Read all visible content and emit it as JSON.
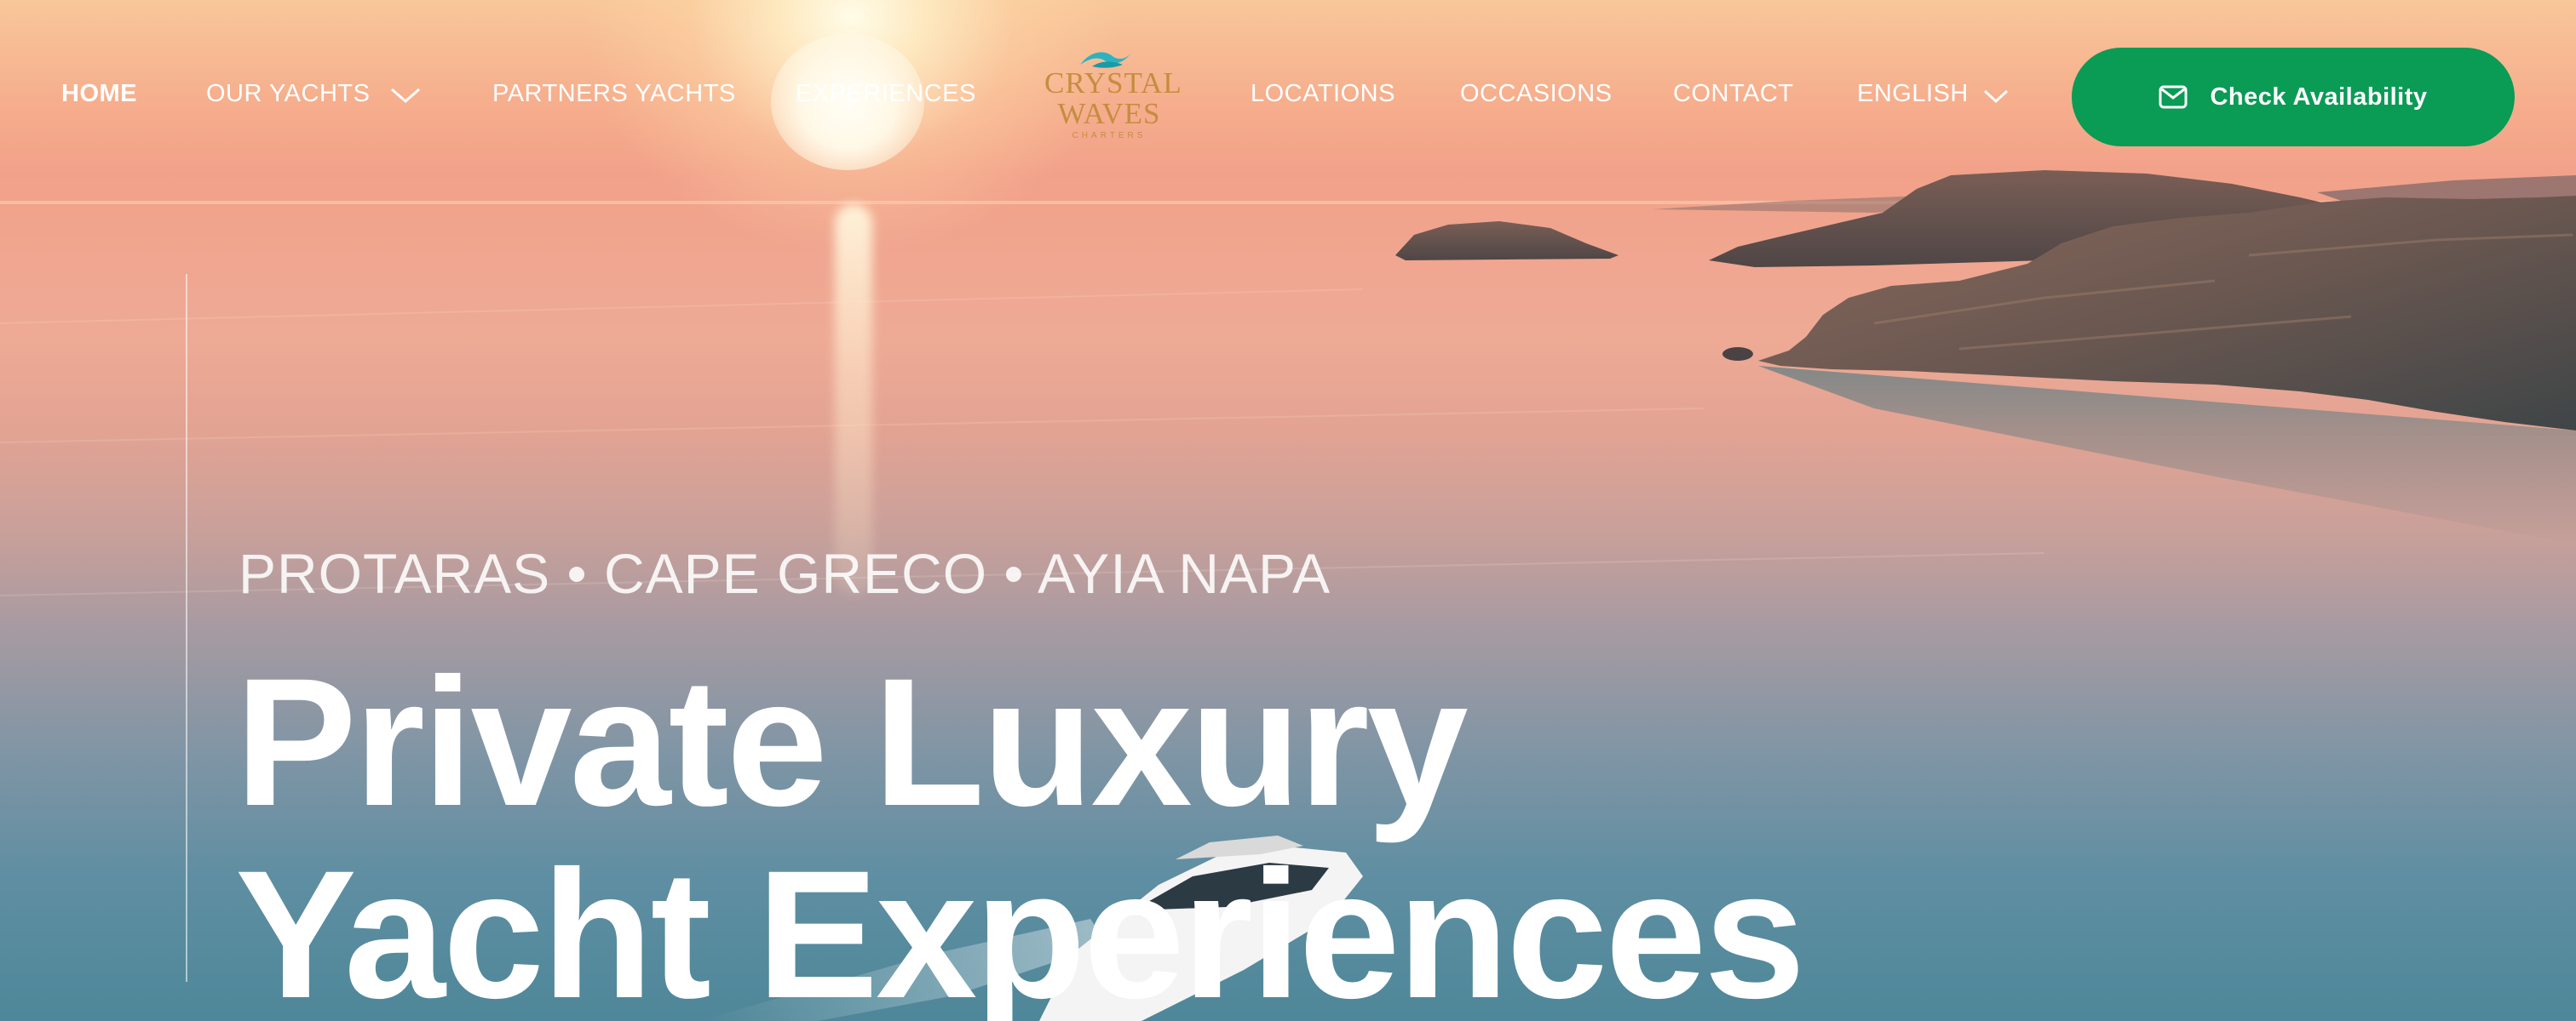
{
  "nav": {
    "items": [
      {
        "label": "HOME",
        "active": true
      },
      {
        "label": "OUR YACHTS",
        "dropdown": true
      },
      {
        "label": "PARTNERS YACHTS"
      },
      {
        "label": "EXPERIENCES"
      },
      {
        "label": "LOCATIONS"
      },
      {
        "label": "OCCASIONS"
      },
      {
        "label": "CONTACT"
      },
      {
        "label": "ENGLISH",
        "dropdown": true
      }
    ],
    "logo": {
      "line1": "CRYSTAL",
      "line2": "WAVES",
      "sub": "CHARTERS"
    },
    "cta": {
      "label": "Check Availability",
      "icon": "mail-icon",
      "color": "#0a9b55"
    }
  },
  "hero": {
    "locations": "PROTARAS • CAPE GRECO • AYIA NAPA",
    "headline_line1": "Private Luxury",
    "headline_line2": "Yacht Experiences"
  },
  "colors": {
    "logo_gold": "#c58d3f",
    "sky_top": "#f8c79a",
    "sea_deep": "#4e8799"
  }
}
